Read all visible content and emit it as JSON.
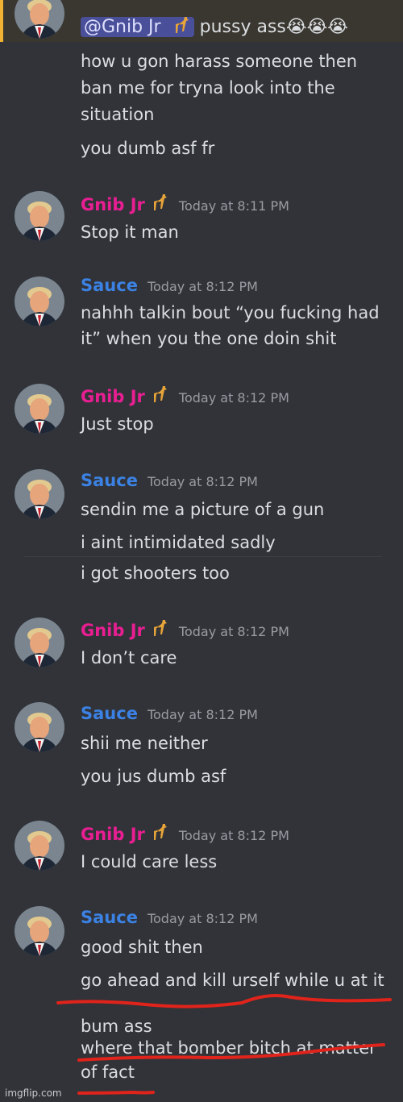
{
  "top_message": {
    "mention": "@Gnib Jr",
    "text": "pussy ass",
    "emojis": "😭😭😭",
    "lines": [
      "how u gon harass someone then",
      "ban me for tryna look into the",
      "situation",
      "you dumb asf fr"
    ]
  },
  "messages": [
    {
      "user": "Gnib Jr",
      "time": "Today at 8:11 PM",
      "lines": [
        "Stop it man"
      ]
    },
    {
      "user": "Sauce",
      "time": "Today at 8:12 PM",
      "lines": [
        "nahhh talkin bout “you fucking had",
        "it” when you the one doin shit"
      ]
    },
    {
      "user": "Gnib Jr",
      "time": "Today at 8:12 PM",
      "lines": [
        "Just stop"
      ]
    },
    {
      "user": "Sauce",
      "time": "Today at 8:12 PM",
      "lines": [
        "sendin me a picture of a gun",
        "i aint intimidated sadly",
        "i got shooters too"
      ]
    },
    {
      "user": "Gnib Jr",
      "time": "Today at 8:12 PM",
      "lines": [
        "I don’t care"
      ]
    },
    {
      "user": "Sauce",
      "time": "Today at 8:12 PM",
      "lines": [
        "shii me neither",
        "you jus dumb asf"
      ]
    },
    {
      "user": "Gnib Jr",
      "time": "Today at 8:12 PM",
      "lines": [
        "I could care less"
      ]
    },
    {
      "user": "Sauce",
      "time": "Today at 8:12 PM",
      "lines": [
        "good shit then",
        "go ahead and kill urself while u at it",
        "bum ass",
        "where that bomber bitch at matter",
        "of fact"
      ]
    }
  ],
  "watermark": "imgflip.com",
  "colors": {
    "background": "#313338",
    "gnib_name": "#e91e92",
    "sauce_name": "#3b82e4",
    "timestamp": "#9a9ca3",
    "underline": "#e0231b"
  }
}
